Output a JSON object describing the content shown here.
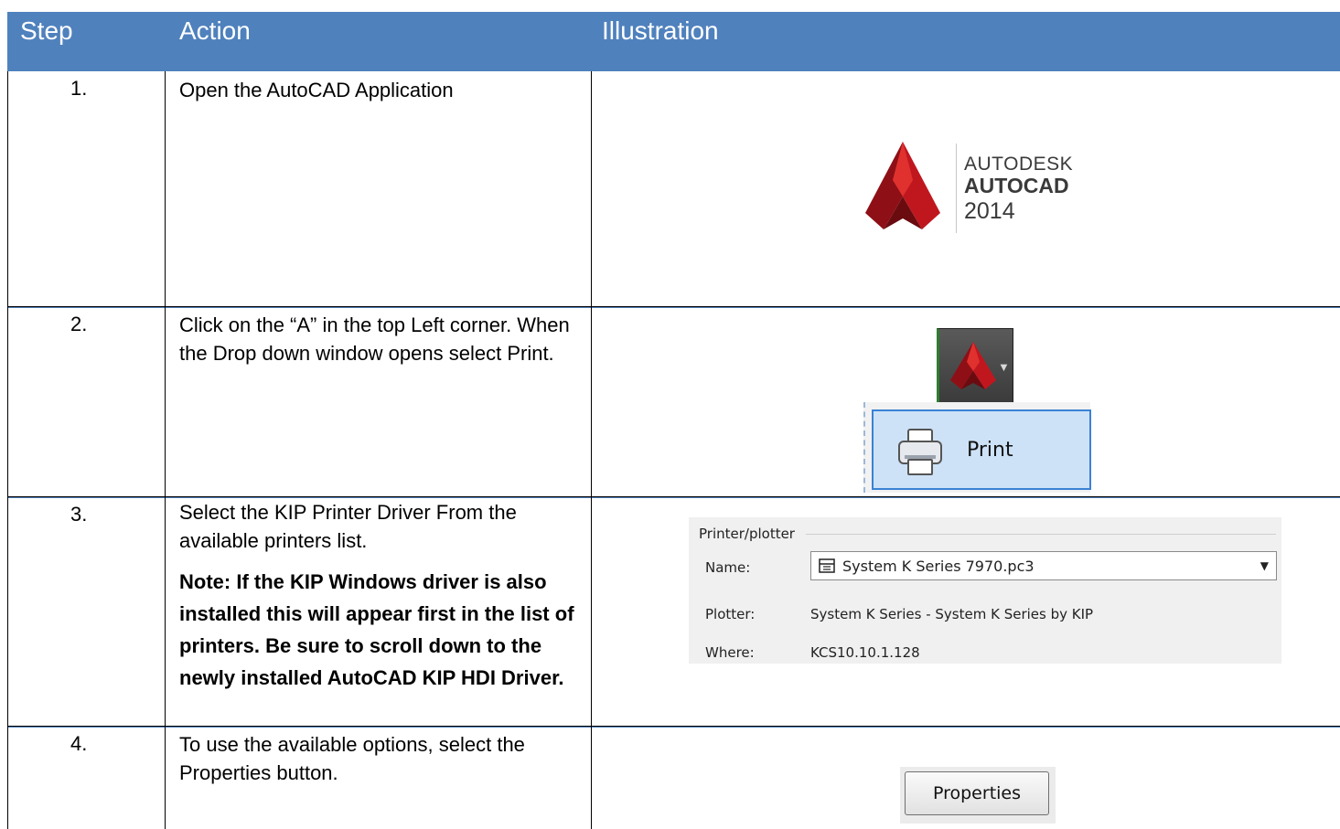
{
  "header": {
    "step": "Step",
    "action": "Action",
    "illustration": "Illustration"
  },
  "rows": [
    {
      "num": "1.",
      "action": "Open the AutoCAD Application"
    },
    {
      "num": "2.",
      "action": "Click on the “A” in the top Left corner. When the Drop down window opens select Print."
    },
    {
      "num": "3.",
      "action": "Select the KIP Printer Driver From the available printers list.",
      "note": "Note: If the KIP Windows driver is also installed this will appear first in the list of printers. Be sure to scroll down to the newly installed AutoCAD KIP HDI Driver."
    },
    {
      "num": "4.",
      "action": "To use the available options, select the Properties button."
    }
  ],
  "logo": {
    "line1": "AUTODESK",
    "line2": "AUTOCAD",
    "line3": "2014",
    "icon": "autocad-logo-icon"
  },
  "app_menu": {
    "print_label": "Print",
    "icon": "autocad-app-icon"
  },
  "printer_panel": {
    "title": "Printer/plotter",
    "name_label": "Name:",
    "name_value": "System K Series 7970.pc3",
    "plotter_label": "Plotter:",
    "plotter_value": "System K Series - System K Series by KIP",
    "where_label": "Where:",
    "where_value": "KCS10.10.1.128"
  },
  "properties_button": "Properties",
  "colors": {
    "header_bg": "#4f81bd",
    "header_text": "#ffffff",
    "logo_red": "#b3151c"
  }
}
